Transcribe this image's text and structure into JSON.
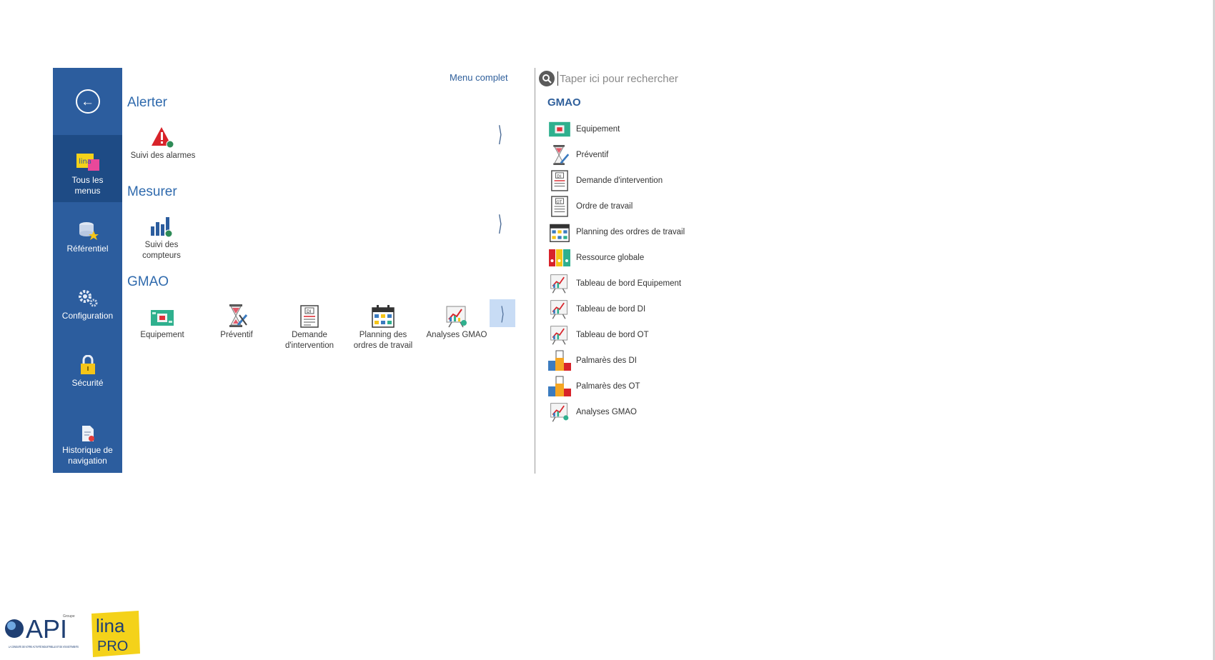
{
  "sidebar": {
    "items": [
      {
        "label": "Tous les menus",
        "icon": "lina-menus-icon"
      },
      {
        "label": "Référentiel",
        "icon": "database-star-icon"
      },
      {
        "label": "Configuration",
        "icon": "gears-icon"
      },
      {
        "label": "Sécurité",
        "icon": "padlock-icon"
      },
      {
        "label": "Historique de navigation",
        "icon": "history-document-icon"
      }
    ]
  },
  "main": {
    "menu_complet": "Menu complet",
    "sections": [
      {
        "title": "Alerter",
        "tiles": [
          {
            "label": "Suivi des alarmes",
            "icon": "alarm-warning-icon"
          }
        ]
      },
      {
        "title": "Mesurer",
        "tiles": [
          {
            "label": "Suivi des compteurs",
            "icon": "counters-chart-icon"
          }
        ]
      },
      {
        "title": "GMAO",
        "tiles": [
          {
            "label": "Equipement",
            "icon": "equipment-board-icon"
          },
          {
            "label": "Préventif",
            "icon": "hourglass-tools-icon"
          },
          {
            "label": "Demande d'intervention",
            "icon": "di-document-icon"
          },
          {
            "label": "Planning des ordres de travail",
            "icon": "planning-calendar-icon"
          },
          {
            "label": "Analyses GMAO",
            "icon": "analysis-board-icon"
          }
        ]
      }
    ]
  },
  "right_panel": {
    "search_placeholder": "Taper ici pour rechercher",
    "heading": "GMAO",
    "items": [
      {
        "label": "Equipement",
        "icon": "equipment-board-icon"
      },
      {
        "label": "Préventif",
        "icon": "hourglass-tools-icon"
      },
      {
        "label": "Demande d'intervention",
        "icon": "di-document-icon"
      },
      {
        "label": "Ordre de travail",
        "icon": "ot-document-icon"
      },
      {
        "label": "Planning des ordres de travail",
        "icon": "planning-calendar-icon"
      },
      {
        "label": "Ressource globale",
        "icon": "resource-binders-icon"
      },
      {
        "label": "Tableau de bord Equipement",
        "icon": "dashboard-board-icon"
      },
      {
        "label": "Tableau de bord DI",
        "icon": "dashboard-board-icon"
      },
      {
        "label": "Tableau de bord OT",
        "icon": "dashboard-board-icon"
      },
      {
        "label": "Palmarès des DI",
        "icon": "podium-icon"
      },
      {
        "label": "Palmarès des OT",
        "icon": "podium-icon"
      },
      {
        "label": "Analyses GMAO",
        "icon": "analysis-board-icon"
      }
    ]
  },
  "logos": {
    "api": {
      "wordmark": "API",
      "group": "Groupe",
      "tagline": "LA CONDUITE DE VOTRE ACTIVITÉ INDUSTRIELLE ET DE VOS BÂTIMENTS"
    },
    "lina": {
      "line1": "lina",
      "line2": "PRO"
    }
  },
  "colors": {
    "sidebar": "#2c5d9e",
    "sidebar_active": "#1e4b85",
    "section_title": "#2f6aad",
    "hover_box": "#c8dcf5"
  }
}
